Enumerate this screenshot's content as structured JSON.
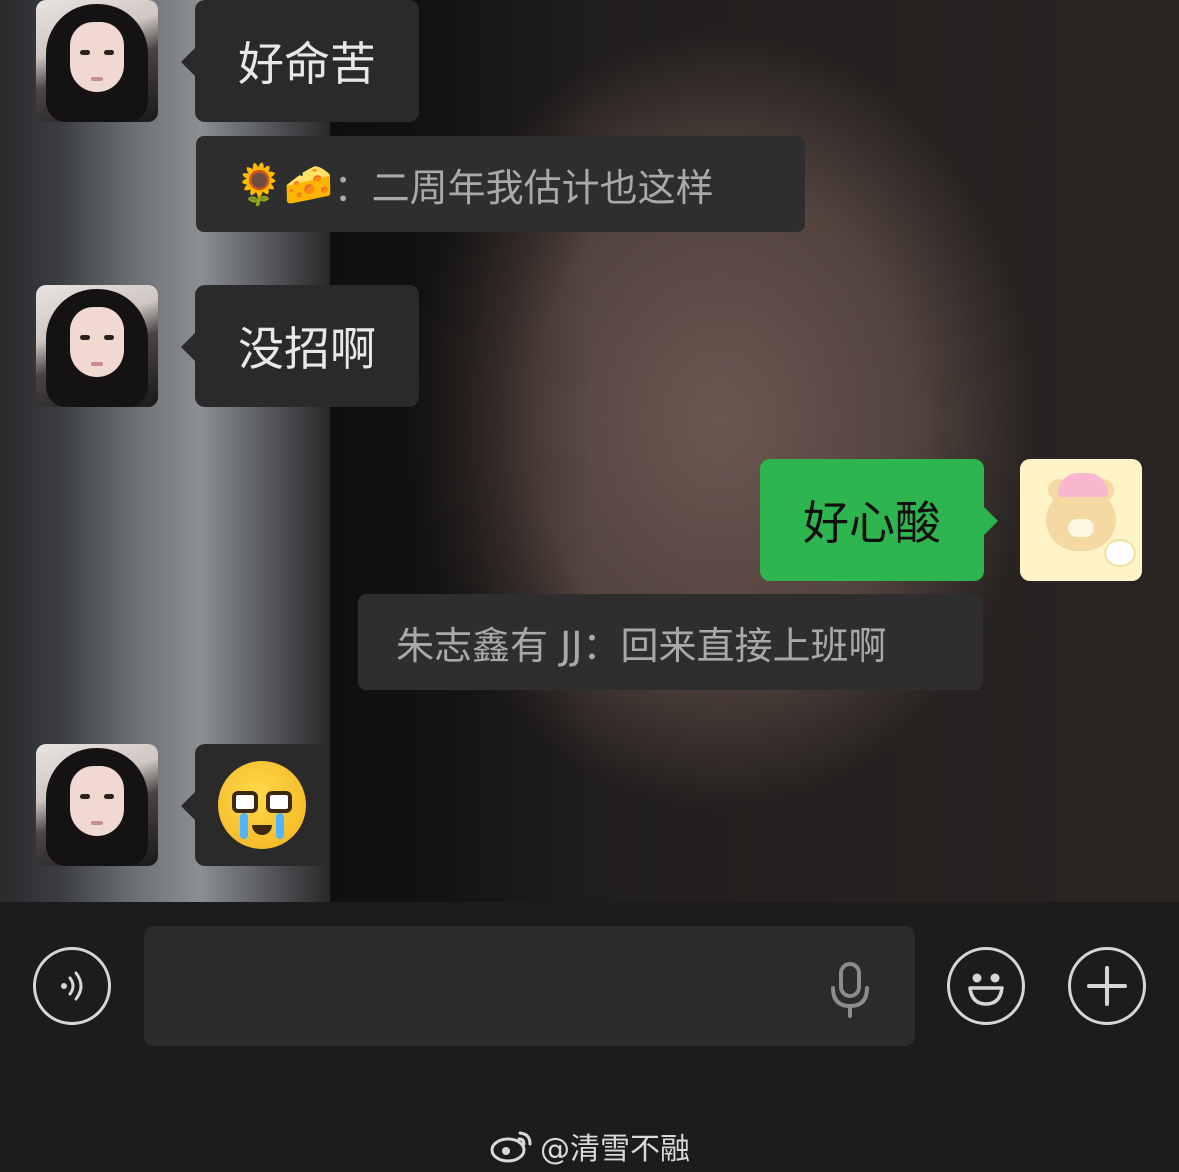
{
  "messages": {
    "m1": {
      "text": "好命苦"
    },
    "quote1": {
      "emoji1": "🌻",
      "emoji2": "🧀",
      "text": "：二周年我估计也这样"
    },
    "m2": {
      "text": "没招啊"
    },
    "m3": {
      "text": "好心酸"
    },
    "quote2": {
      "text": "朱志鑫有 JJ：回来直接上班啊"
    },
    "m4": {
      "emoji": "crying-face-with-glasses"
    }
  },
  "input": {
    "placeholder": ""
  },
  "icons": {
    "voice": "voice-icon",
    "mic": "mic-icon",
    "emoji": "smiley-icon",
    "plus": "plus-icon"
  },
  "watermark": {
    "handle": "@清雪不融"
  },
  "colors": {
    "my_bubble": "#2fb54f",
    "other_bubble": "#2a2a2a",
    "background": "#1c1c1c"
  }
}
